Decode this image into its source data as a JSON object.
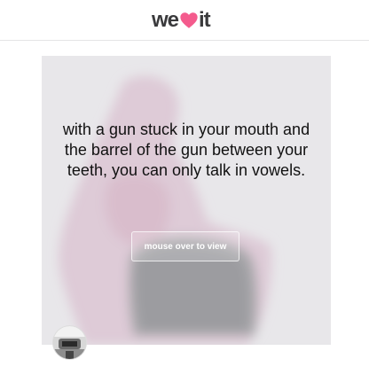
{
  "header": {
    "logo_text_left": "we",
    "logo_text_right": "it",
    "logo_icon": "heart-icon",
    "accent_color": "#f45b8d"
  },
  "post": {
    "quote": "with a gun stuck in your mouth and the barrel of the gun between your teeth, you can only talk in vowels.",
    "reveal_label": "mouse over to view",
    "background_color": "#e8e7ea"
  },
  "user": {
    "avatar_icon": "user-avatar"
  }
}
